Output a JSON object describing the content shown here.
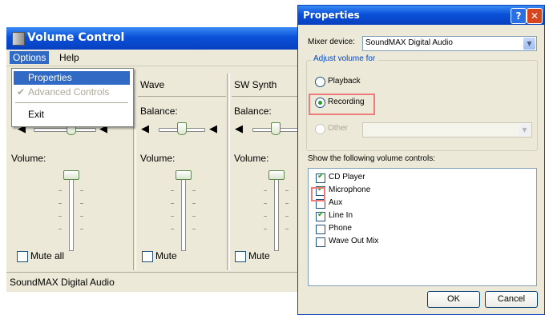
{
  "volume_control": {
    "title": "Volume Control",
    "menu": {
      "options": "Options",
      "help": "Help"
    },
    "dropdown": {
      "properties": "Properties",
      "advanced_controls": "Advanced Controls",
      "advanced_check": "✔",
      "exit": "Exit"
    },
    "columns": [
      {
        "name": "",
        "balance_label": "",
        "volume_label": "Volume:",
        "mute_label": "Mute all"
      },
      {
        "name": "Wave",
        "balance_label": "Balance:",
        "volume_label": "Volume:",
        "mute_label": "Mute"
      },
      {
        "name": "SW Synth",
        "balance_label": "Balance:",
        "volume_label": "Volume:",
        "mute_label": "Mute"
      }
    ],
    "status": "SoundMAX Digital Audio"
  },
  "properties": {
    "title": "Properties",
    "help_btn": "?",
    "close_btn": "✕",
    "mixer_label": "Mixer device:",
    "mixer_value": "SoundMAX Digital Audio",
    "adjust_group": "Adjust volume for",
    "radios": [
      {
        "label": "Playback",
        "selected": false
      },
      {
        "label": "Recording",
        "selected": true
      },
      {
        "label": "Other",
        "selected": false
      }
    ],
    "show_label": "Show the following volume controls:",
    "controls": [
      {
        "label": "CD Player",
        "checked": true
      },
      {
        "label": "Microphone",
        "checked": true
      },
      {
        "label": "Aux",
        "checked": false
      },
      {
        "label": "Line In",
        "checked": true
      },
      {
        "label": "Phone",
        "checked": false
      },
      {
        "label": "Wave Out Mix",
        "checked": false
      }
    ],
    "check_mark": "✔",
    "ok": "OK",
    "cancel": "Cancel"
  }
}
